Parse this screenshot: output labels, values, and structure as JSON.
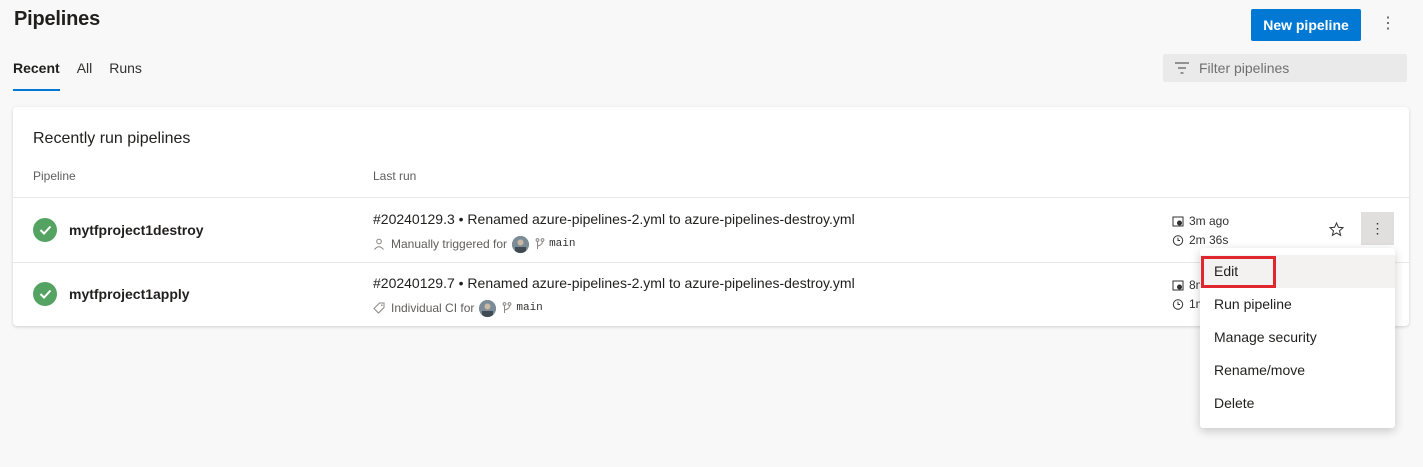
{
  "header": {
    "title": "Pipelines",
    "new_button": "New pipeline",
    "more_glyph": "⋮"
  },
  "tabs": [
    {
      "label": "Recent",
      "active": true
    },
    {
      "label": "All",
      "active": false
    },
    {
      "label": "Runs",
      "active": false
    }
  ],
  "filter": {
    "placeholder": "Filter pipelines",
    "icon": "filter-icon"
  },
  "card": {
    "title": "Recently run pipelines",
    "columns": {
      "pipeline": "Pipeline",
      "last_run": "Last run"
    }
  },
  "rows": [
    {
      "name": "mytfproject1destroy",
      "status": "succeeded",
      "run_title": "#20240129.3 • Renamed azure-pipelines-2.yml to azure-pipelines-destroy.yml",
      "trigger": "Manually triggered for",
      "trigger_icon": "person-icon",
      "branch": "main",
      "time_ago": "3m ago",
      "duration": "2m 36s"
    },
    {
      "name": "mytfproject1apply",
      "status": "succeeded",
      "run_title": "#20240129.7 • Renamed azure-pipelines-2.yml to azure-pipelines-destroy.yml",
      "trigger": "Individual CI for",
      "trigger_icon": "tag-icon",
      "branch": "main",
      "time_ago": "8m",
      "duration": "1m"
    }
  ],
  "context_menu": {
    "items": [
      "Edit",
      "Run pipeline",
      "Manage security",
      "Rename/move",
      "Delete"
    ],
    "highlighted": "Edit"
  },
  "colors": {
    "accent": "#0078d4",
    "success": "#55a362",
    "highlight_border": "#e0262e"
  }
}
